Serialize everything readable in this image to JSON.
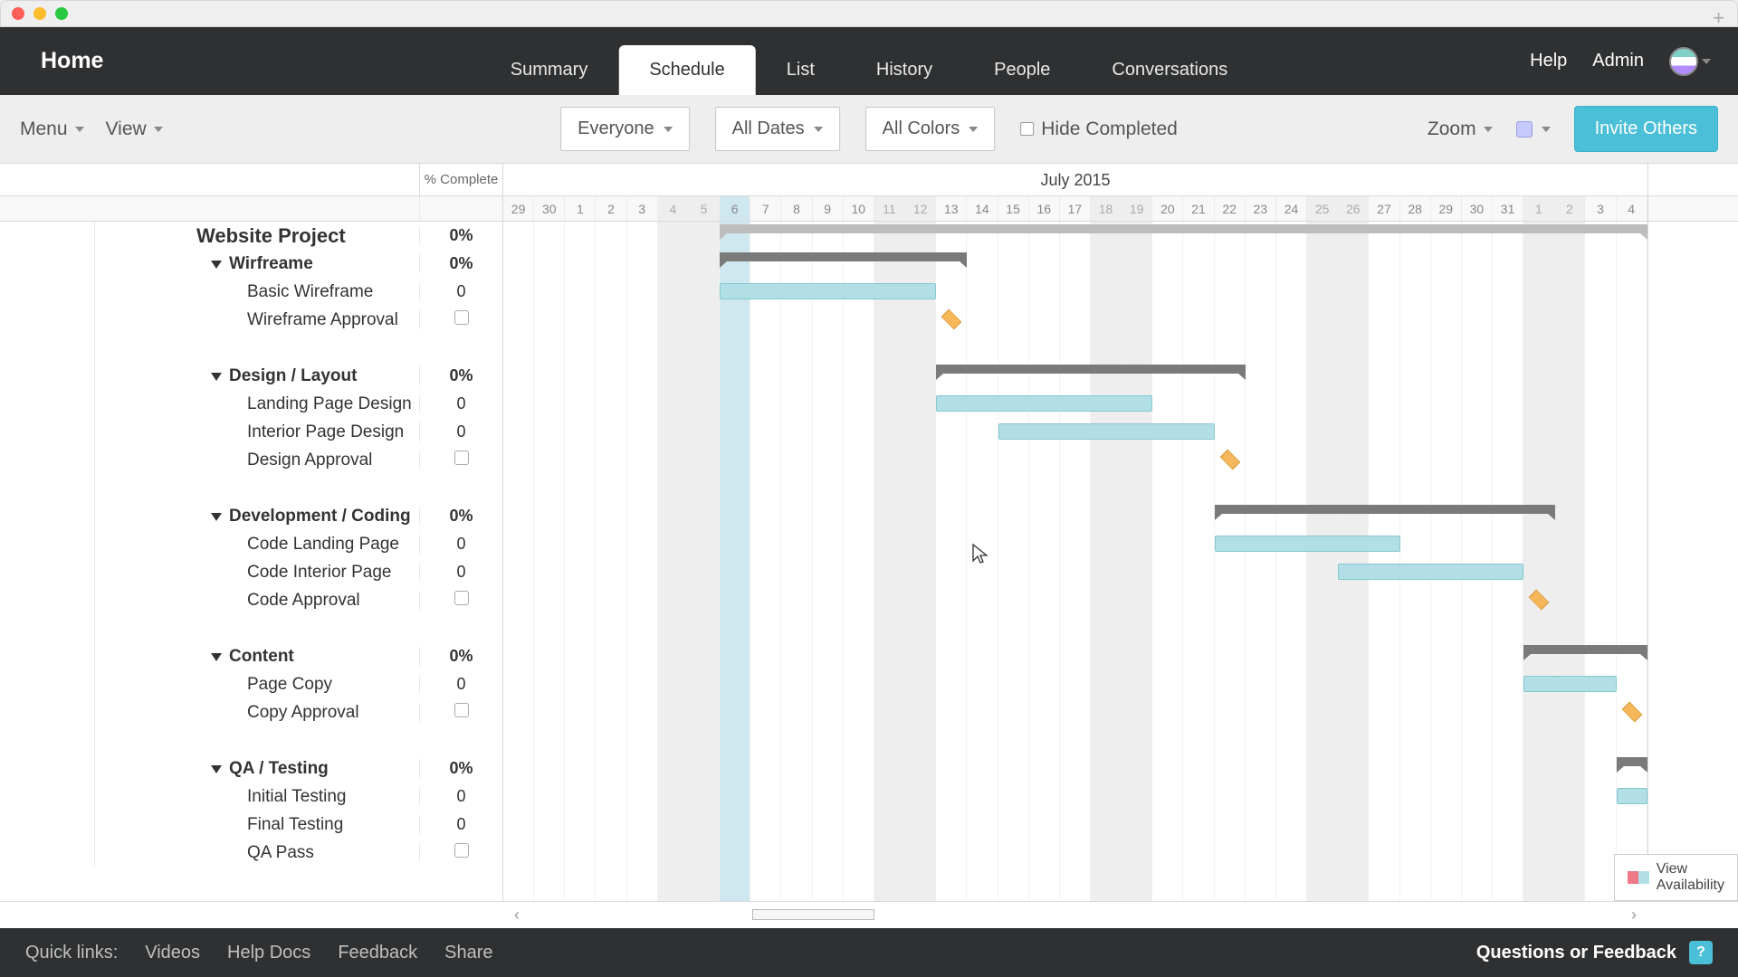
{
  "colors": {
    "accent": "#4bbfd7",
    "bar": "#b2dfe5",
    "summary": "#7a7a7a",
    "milestone": "#f5b759"
  },
  "header": {
    "home": "Home",
    "tabs": [
      "Summary",
      "Schedule",
      "List",
      "History",
      "People",
      "Conversations"
    ],
    "active_tab": "Schedule",
    "help": "Help",
    "admin": "Admin"
  },
  "toolbar": {
    "menu": "Menu",
    "view": "View",
    "everyone": "Everyone",
    "all_dates": "All Dates",
    "all_colors": "All Colors",
    "hide_completed": "Hide Completed",
    "zoom": "Zoom",
    "invite": "Invite Others"
  },
  "columns": {
    "pct_header": "% Complete"
  },
  "timeline": {
    "month_label": "July 2015",
    "days": [
      {
        "n": "29",
        "w": false
      },
      {
        "n": "30",
        "w": false
      },
      {
        "n": "1",
        "w": false
      },
      {
        "n": "2",
        "w": false
      },
      {
        "n": "3",
        "w": false
      },
      {
        "n": "4",
        "w": true
      },
      {
        "n": "5",
        "w": true
      },
      {
        "n": "6",
        "w": false,
        "today": true
      },
      {
        "n": "7",
        "w": false
      },
      {
        "n": "8",
        "w": false
      },
      {
        "n": "9",
        "w": false
      },
      {
        "n": "10",
        "w": false
      },
      {
        "n": "11",
        "w": true
      },
      {
        "n": "12",
        "w": true
      },
      {
        "n": "13",
        "w": false
      },
      {
        "n": "14",
        "w": false
      },
      {
        "n": "15",
        "w": false
      },
      {
        "n": "16",
        "w": false
      },
      {
        "n": "17",
        "w": false
      },
      {
        "n": "18",
        "w": true
      },
      {
        "n": "19",
        "w": true
      },
      {
        "n": "20",
        "w": false
      },
      {
        "n": "21",
        "w": false
      },
      {
        "n": "22",
        "w": false
      },
      {
        "n": "23",
        "w": false
      },
      {
        "n": "24",
        "w": false
      },
      {
        "n": "25",
        "w": true
      },
      {
        "n": "26",
        "w": true
      },
      {
        "n": "27",
        "w": false
      },
      {
        "n": "28",
        "w": false
      },
      {
        "n": "29",
        "w": false
      },
      {
        "n": "30",
        "w": false
      },
      {
        "n": "31",
        "w": false
      },
      {
        "n": "1",
        "w": true
      },
      {
        "n": "2",
        "w": true
      },
      {
        "n": "3",
        "w": false
      },
      {
        "n": "4",
        "w": false
      }
    ]
  },
  "rows": [
    {
      "type": "project",
      "name": "Website Project",
      "pct": "0%",
      "bar": {
        "kind": "sum",
        "cls": "lt",
        "s": 7,
        "e": 40
      }
    },
    {
      "type": "group",
      "name": "Wirfreame",
      "pct": "0%",
      "bar": {
        "kind": "sum",
        "s": 7,
        "e": 15
      }
    },
    {
      "type": "task",
      "name": "Basic Wireframe",
      "pct": "0",
      "bar": {
        "kind": "task",
        "s": 7,
        "e": 14
      }
    },
    {
      "type": "task",
      "name": "Wireframe Approval",
      "pct": "chk",
      "bar": {
        "kind": "ms",
        "s": 14.5
      }
    },
    {
      "type": "spacer"
    },
    {
      "type": "group",
      "name": "Design / Layout",
      "pct": "0%",
      "bar": {
        "kind": "sum",
        "s": 14,
        "e": 24
      }
    },
    {
      "type": "task",
      "name": "Landing Page Design",
      "pct": "0",
      "bar": {
        "kind": "task",
        "s": 14,
        "e": 21
      }
    },
    {
      "type": "task",
      "name": "Interior Page Design",
      "pct": "0",
      "bar": {
        "kind": "task",
        "s": 16,
        "e": 23
      }
    },
    {
      "type": "task",
      "name": "Design Approval",
      "pct": "chk",
      "bar": {
        "kind": "ms",
        "s": 23.5
      }
    },
    {
      "type": "spacer"
    },
    {
      "type": "group",
      "name": "Development / Coding",
      "pct": "0%",
      "bar": {
        "kind": "sum",
        "s": 23,
        "e": 34
      }
    },
    {
      "type": "task",
      "name": "Code Landing Page",
      "pct": "0",
      "bar": {
        "kind": "task",
        "s": 23,
        "e": 29
      }
    },
    {
      "type": "task",
      "name": "Code Interior Page",
      "pct": "0",
      "bar": {
        "kind": "task",
        "s": 27,
        "e": 33
      }
    },
    {
      "type": "task",
      "name": "Code Approval",
      "pct": "chk",
      "bar": {
        "kind": "ms",
        "s": 33.5
      }
    },
    {
      "type": "spacer"
    },
    {
      "type": "group",
      "name": "Content",
      "pct": "0%",
      "bar": {
        "kind": "sum",
        "s": 33,
        "e": 40
      }
    },
    {
      "type": "task",
      "name": "Page Copy",
      "pct": "0",
      "bar": {
        "kind": "task",
        "s": 33,
        "e": 36
      }
    },
    {
      "type": "task",
      "name": "Copy Approval",
      "pct": "chk",
      "bar": {
        "kind": "ms",
        "s": 36.5
      }
    },
    {
      "type": "spacer"
    },
    {
      "type": "group",
      "name": "QA / Testing",
      "pct": "0%",
      "bar": {
        "kind": "sum",
        "s": 36,
        "e": 40
      }
    },
    {
      "type": "task",
      "name": "Initial Testing",
      "pct": "0",
      "bar": {
        "kind": "task",
        "s": 36,
        "e": 40
      }
    },
    {
      "type": "task",
      "name": "Final Testing",
      "pct": "0"
    },
    {
      "type": "task",
      "name": "QA Pass",
      "pct": "chk"
    }
  ],
  "availability": "View Availability",
  "footer": {
    "quick": "Quick links:",
    "links": [
      "Videos",
      "Help Docs",
      "Feedback",
      "Share"
    ],
    "qf": "Questions or Feedback",
    "qmark": "?"
  }
}
